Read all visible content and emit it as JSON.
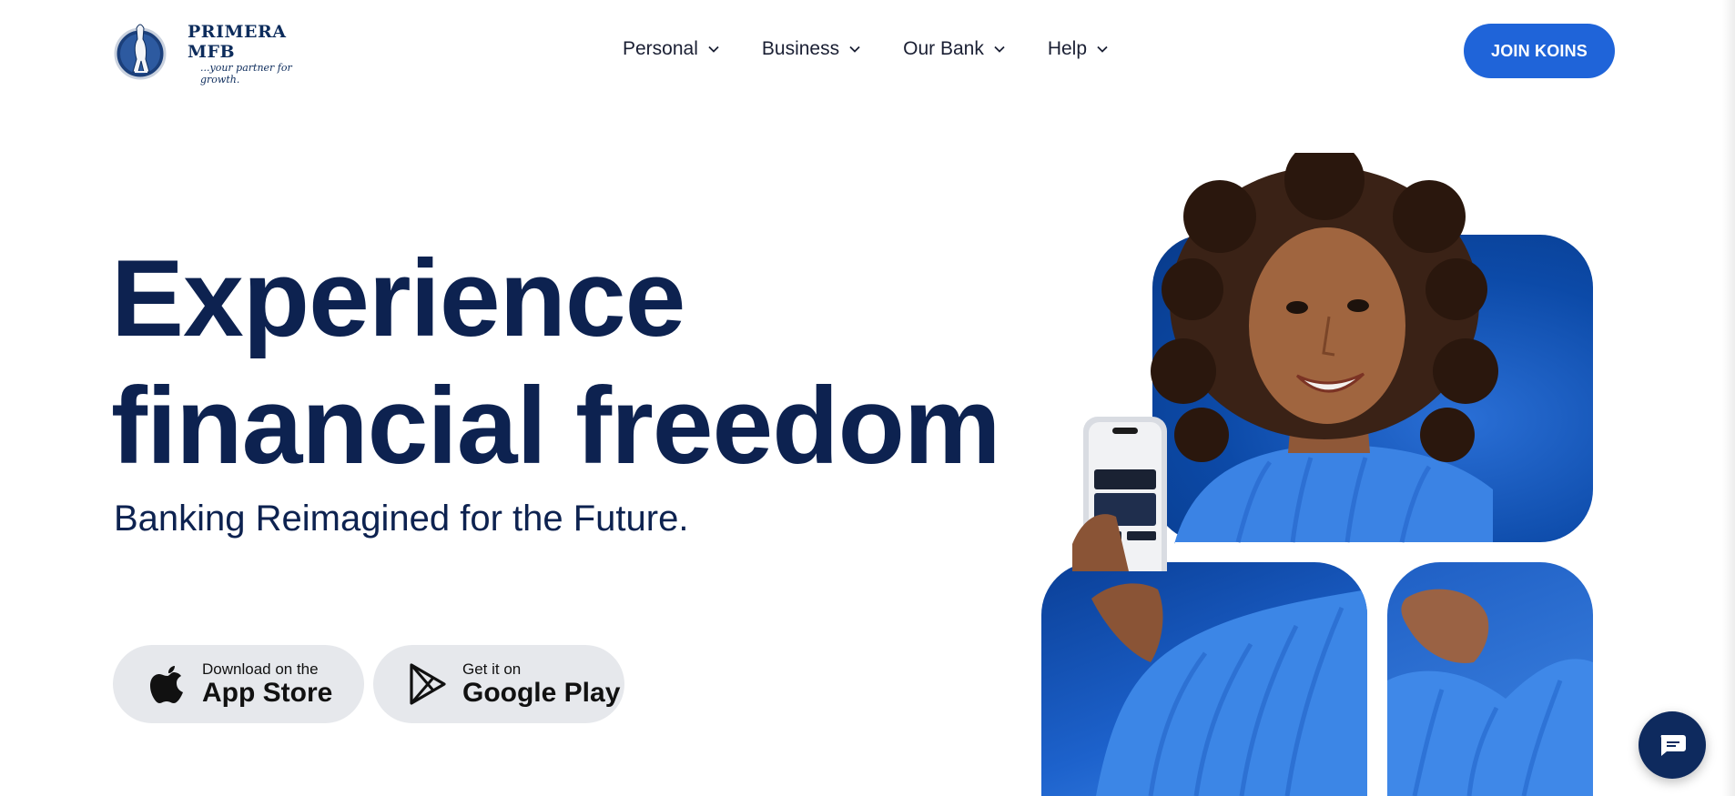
{
  "brand": {
    "name": "PRIMERA MFB",
    "tagline": "...your partner for growth."
  },
  "nav": {
    "items": [
      {
        "label": "Personal",
        "icon": "chevron-down-icon"
      },
      {
        "label": "Business",
        "icon": "chevron-down-icon"
      },
      {
        "label": "Our Bank",
        "icon": "chevron-down-icon"
      },
      {
        "label": "Help",
        "icon": "chevron-down-icon"
      }
    ],
    "cta_label": "JOIN KOINS"
  },
  "hero": {
    "title_line1": "Experience",
    "title_line2": "financial freedom",
    "subtitle": "Banking Reimagined for the Future."
  },
  "stores": {
    "apple": {
      "small": "Download on the",
      "big": "App Store",
      "icon": "apple-icon"
    },
    "google": {
      "small": "Get it on",
      "big": "Google Play",
      "icon": "google-play-icon"
    }
  },
  "chat": {
    "icon": "chat-icon"
  },
  "colors": {
    "primary": "#0d2250",
    "accent": "#1f64d9",
    "panel_blue": "#0c4aa8",
    "button_gray": "#e6e8ec"
  }
}
